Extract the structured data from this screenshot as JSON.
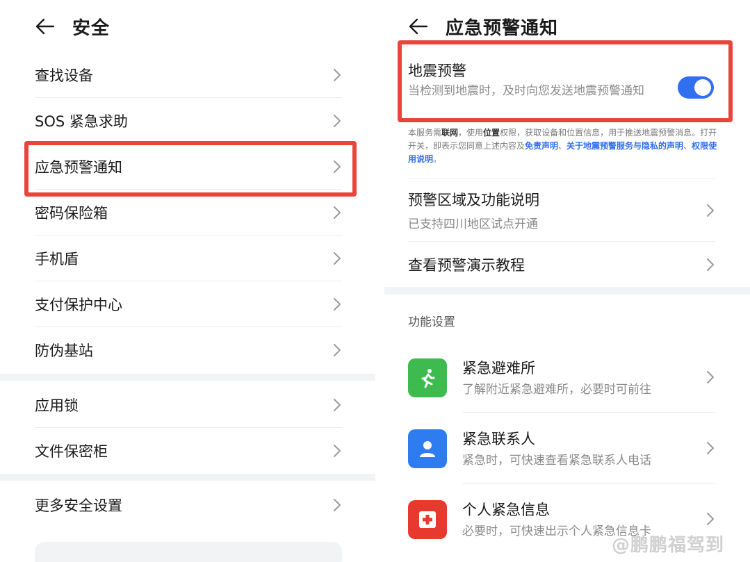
{
  "left": {
    "title": "安全",
    "items": [
      {
        "label": "查找设备"
      },
      {
        "label": "SOS 紧急求助"
      },
      {
        "label": "应急预警通知"
      },
      {
        "label": "密码保险箱"
      },
      {
        "label": "手机盾"
      },
      {
        "label": "支付保护中心"
      },
      {
        "label": "防伪基站"
      },
      {
        "label": "应用锁"
      },
      {
        "label": "文件保密柜"
      },
      {
        "label": "更多安全设置"
      }
    ]
  },
  "right": {
    "title": "应急预警通知",
    "earthquake": {
      "title": "地震预警",
      "description": "当检测到地震时，及时向您发送地震预警通知",
      "enabled": true
    },
    "disclaimer": {
      "p1": "本服务需",
      "b1": "联网",
      "p2": "，使用",
      "b2": "位置",
      "p3": "权限，获取设备和位置信息，用于推送地震预警消息。打开开关，即表示您同意上述内容及",
      "link1": "免责声明",
      "sep": "、",
      "link2": "关于地震预警服务与隐私的声明",
      "link3": "权限使用说明",
      "end": "。"
    },
    "rows": [
      {
        "title": "预警区域及功能说明",
        "subtitle": "已支持四川地区试点开通"
      },
      {
        "title": "查看预警演示教程"
      }
    ],
    "section_label": "功能设置",
    "features": [
      {
        "title": "紧急避难所",
        "subtitle": "了解附近紧急避难所，必要时可前往",
        "icon": "running-person-icon",
        "color": "#3dbb4f"
      },
      {
        "title": "紧急联系人",
        "subtitle": "紧急时，可快速查看紧急联系人电话",
        "icon": "contact-person-icon",
        "color": "#2f7cf0"
      },
      {
        "title": "个人紧急信息",
        "subtitle": "必要时，可快速出示个人紧急信息卡",
        "icon": "medical-cross-icon",
        "color": "#e8392f"
      }
    ]
  },
  "watermark": "@鹏鹏福驾到",
  "colors": {
    "accent": "#2f6ff0",
    "highlight": "#e8453c",
    "band": "#f1f3f5"
  }
}
